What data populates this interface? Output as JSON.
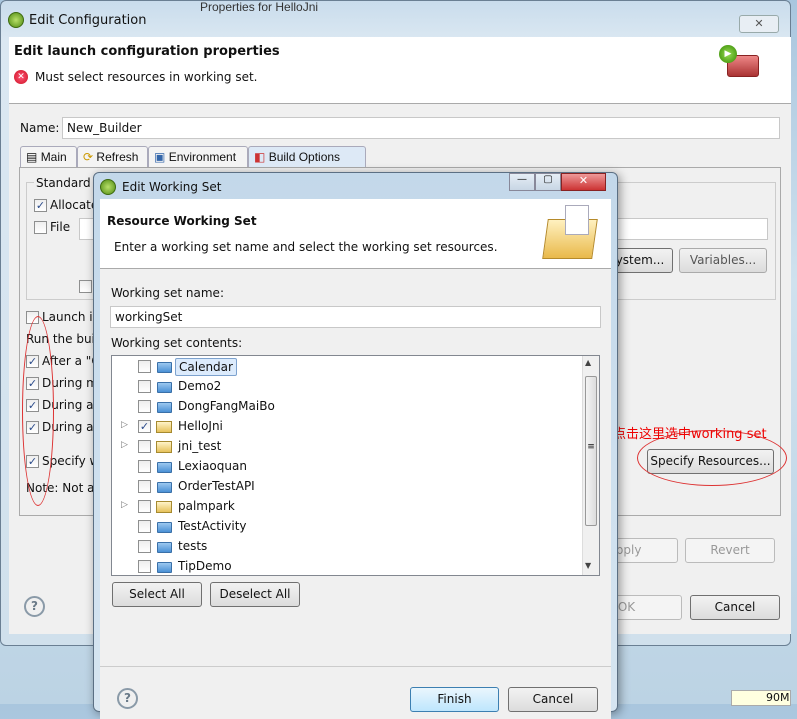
{
  "background_window": {
    "title": "Properties for HelloJni"
  },
  "dialog": {
    "title": "Edit Configuration",
    "close_icon": "close-icon",
    "header_title": "Edit launch configuration properties",
    "error_message": "Must select resources in working set.",
    "name_label": "Name:",
    "name_value": "New_Builder",
    "tabs": [
      {
        "label": "Main",
        "icon": "main-tab-icon"
      },
      {
        "label": "Refresh",
        "icon": "refresh-icon"
      },
      {
        "label": "Environment",
        "icon": "environment-icon"
      },
      {
        "label": "Build Options",
        "icon": "build-options-icon",
        "active": true
      }
    ],
    "standard_group": "Standard I",
    "allocate": {
      "label": "Allocate",
      "checked": true
    },
    "file": {
      "label": "File",
      "checked": false
    },
    "system_button": "ystem...",
    "variables_button": "Variables...",
    "launch_in": {
      "label": "Launch in",
      "checked": false
    },
    "run_builder": "Run the buil",
    "run_options": [
      {
        "label": "After a \"C",
        "checked": true
      },
      {
        "label": "During m",
        "checked": true
      },
      {
        "label": "During au",
        "checked": true
      },
      {
        "label": "During a",
        "checked": true
      }
    ],
    "specify": {
      "label": "Specify w",
      "checked": true
    },
    "note": "Note: Not a",
    "specify_resources_button": "Specify Resources...",
    "apply_button": "Apply",
    "revert_button": "Revert",
    "ok_button": "OK",
    "cancel_button": "Cancel"
  },
  "annotation": {
    "text": "点击这里选中working set",
    "color": "#e00000"
  },
  "working_set_dialog": {
    "title": "Edit Working Set",
    "header_title": "Resource Working Set",
    "header_description": "Enter a working set name and select the working set resources.",
    "name_label": "Working set name:",
    "name_value": "workingSet",
    "contents_label": "Working set contents:",
    "items": [
      {
        "label": "Calendar",
        "checked": false,
        "expandable": false,
        "type": "folder",
        "selected": true
      },
      {
        "label": "Demo2",
        "checked": false,
        "expandable": false,
        "type": "folder"
      },
      {
        "label": "DongFangMaiBo",
        "checked": false,
        "expandable": false,
        "type": "folder"
      },
      {
        "label": "HelloJni",
        "checked": true,
        "expandable": true,
        "type": "project"
      },
      {
        "label": "jni_test",
        "checked": false,
        "expandable": true,
        "type": "project"
      },
      {
        "label": "Lexiaoquan",
        "checked": false,
        "expandable": false,
        "type": "folder"
      },
      {
        "label": "OrderTestAPI",
        "checked": false,
        "expandable": false,
        "type": "folder"
      },
      {
        "label": "palmpark",
        "checked": false,
        "expandable": true,
        "type": "project"
      },
      {
        "label": "TestActivity",
        "checked": false,
        "expandable": false,
        "type": "folder"
      },
      {
        "label": "tests",
        "checked": false,
        "expandable": false,
        "type": "folder"
      },
      {
        "label": "TipDemo",
        "checked": false,
        "expandable": false,
        "type": "folder"
      }
    ],
    "select_all_button": "Select All",
    "deselect_all_button": "Deselect All",
    "finish_button": "Finish",
    "cancel_button": "Cancel"
  },
  "status": {
    "memory": "90M"
  }
}
